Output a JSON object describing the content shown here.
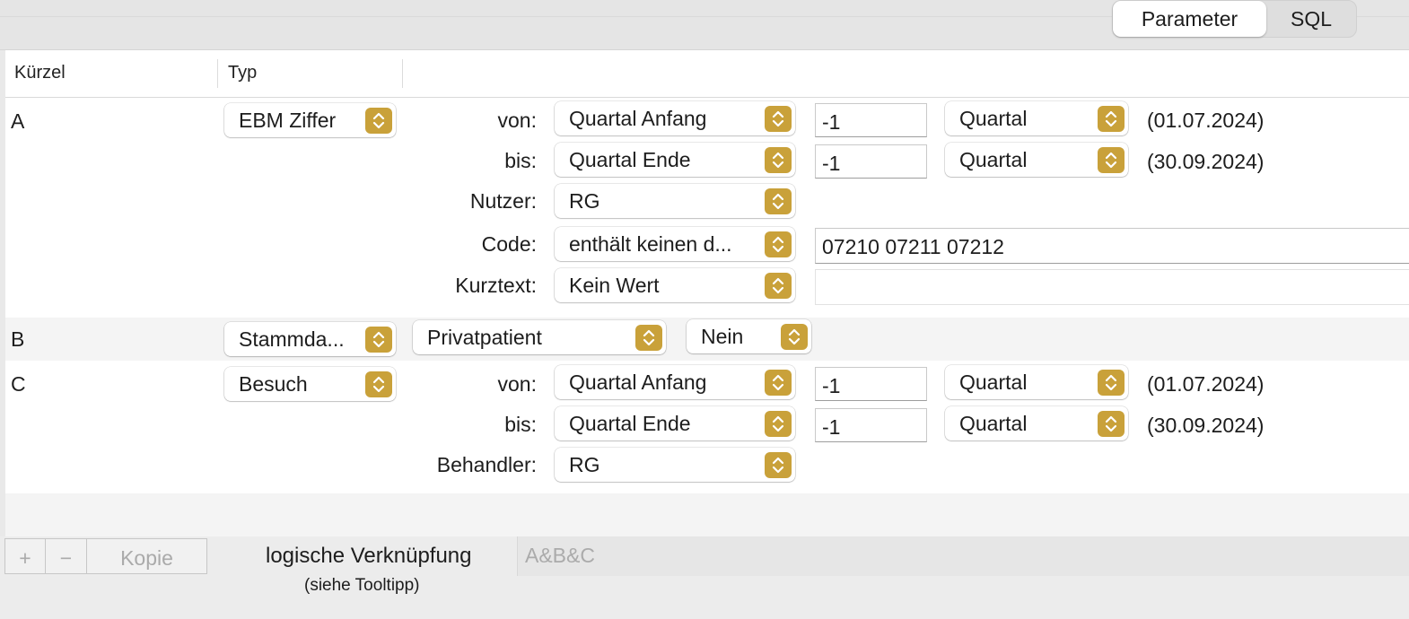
{
  "tabs": {
    "parameter": "Parameter",
    "sql": "SQL"
  },
  "table": {
    "col_kuerzel": "Kürzel",
    "col_typ": "Typ"
  },
  "rows": {
    "a": {
      "kuerzel": "A",
      "typ": "EBM Ziffer",
      "von_label": "von:",
      "von_value": "Quartal Anfang",
      "von_offset": "-1",
      "von_unit": "Quartal",
      "von_date": "(01.07.2024)",
      "bis_label": "bis:",
      "bis_value": "Quartal Ende",
      "bis_offset": "-1",
      "bis_unit": "Quartal",
      "bis_date": "(30.09.2024)",
      "nutzer_label": "Nutzer:",
      "nutzer_value": "RG",
      "code_label": "Code:",
      "code_op": "enthält keinen d...",
      "code_value": "07210 07211 07212",
      "kurztext_label": "Kurztext:",
      "kurztext_op": "Kein Wert",
      "kurztext_value": ""
    },
    "b": {
      "kuerzel": "B",
      "typ": "Stammda...",
      "field": "Privatpatient",
      "value": "Nein"
    },
    "c": {
      "kuerzel": "C",
      "typ": "Besuch",
      "von_label": "von:",
      "von_value": "Quartal Anfang",
      "von_offset": "-1",
      "von_unit": "Quartal",
      "von_date": "(01.07.2024)",
      "bis_label": "bis:",
      "bis_value": "Quartal Ende",
      "bis_offset": "-1",
      "bis_unit": "Quartal",
      "bis_date": "(30.09.2024)",
      "behandler_label": "Behandler:",
      "behandler_value": "RG"
    }
  },
  "bottom": {
    "add": "+",
    "remove": "−",
    "copy": "Kopie",
    "logic_label": "logische Verknüpfung",
    "logic_hint": "(siehe Tooltipp)",
    "logic_placeholder": "A&B&C"
  },
  "colors": {
    "accent": "#c9a13a",
    "row_alt": "#f4f4f4"
  }
}
